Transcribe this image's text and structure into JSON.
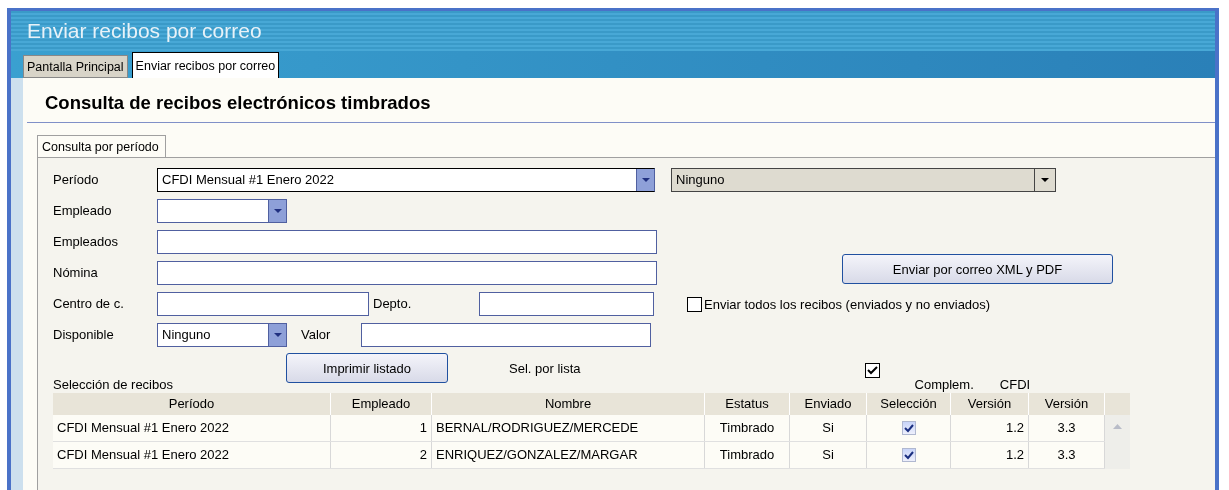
{
  "window": {
    "title": "Enviar recibos por correo"
  },
  "tabs": [
    {
      "label": "Pantalla Principal",
      "selected": false
    },
    {
      "label": "Enviar recibos por correo",
      "selected": true
    }
  ],
  "heading": "Consulta de recibos electrónicos timbrados",
  "group_tabs": [
    {
      "label": "Consulta por período",
      "selected": true
    }
  ],
  "form": {
    "periodo": {
      "label": "Período",
      "value": "CFDI Mensual #1 Enero 2022"
    },
    "periodo_filter": {
      "value": "Ninguno",
      "disabled": true
    },
    "empleado": {
      "label": "Empleado"
    },
    "empleados": {
      "label": "Empleados"
    },
    "nomina": {
      "label": "Nómina"
    },
    "centro": {
      "label": "Centro de c."
    },
    "depto": {
      "label": "Depto."
    },
    "disponible": {
      "label": "Disponible",
      "value": "Ninguno"
    },
    "valor": {
      "label": "Valor"
    }
  },
  "send_button": "Enviar por correo XML y PDF",
  "send_all": {
    "label": "Enviar todos los recibos (enviados y no enviados)",
    "checked": false
  },
  "print_button": "Imprimir listado",
  "sel_por_lista": "Sel. por lista",
  "select_all": {
    "checked": true
  },
  "header_extra": [
    "Complem.",
    "CFDI"
  ],
  "table": {
    "caption": "Selección de recibos",
    "columns": [
      "Período",
      "Empleado",
      "Nombre",
      "Estatus",
      "Enviado",
      "Selección",
      "Versión",
      "Versión"
    ],
    "rows": [
      {
        "periodo": "CFDI Mensual #1 Enero 2022",
        "empleado": "1",
        "nombre": "BERNAL/RODRIGUEZ/MERCEDE",
        "estatus": "Timbrado",
        "enviado": "Si",
        "checked": true,
        "complem": "1.2",
        "cfdi": "3.3"
      },
      {
        "periodo": "CFDI Mensual #1 Enero 2022",
        "empleado": "2",
        "nombre": "ENRIQUEZ/GONZALEZ/MARGAR",
        "estatus": "Timbrado",
        "enviado": "Si",
        "checked": true,
        "complem": "1.2",
        "cfdi": "3.3"
      }
    ]
  }
}
